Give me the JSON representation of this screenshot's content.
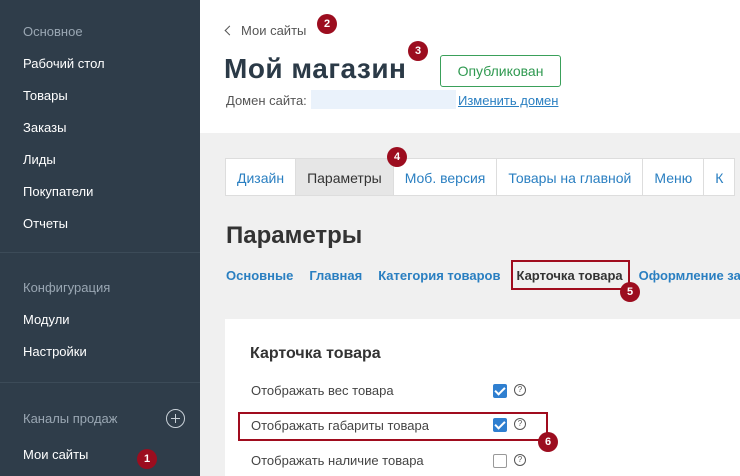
{
  "sidebar": {
    "section_main": "Основное",
    "items_main": [
      "Рабочий стол",
      "Товары",
      "Заказы",
      "Лиды",
      "Покупатели",
      "Отчеты"
    ],
    "section_config": "Конфигурация",
    "items_config": [
      "Модули",
      "Настройки"
    ],
    "section_channels": "Каналы продаж",
    "items_channels": [
      "Мои сайты"
    ]
  },
  "header": {
    "back_label": "Мои сайты",
    "site_title": "Мой магазин",
    "status_label": "Опубликован",
    "domain_label": "Домен сайта:",
    "domain_change_link": "Изменить домен"
  },
  "tabs": [
    "Дизайн",
    "Параметры",
    "Моб. версия",
    "Товары на главной",
    "Меню",
    "К"
  ],
  "params": {
    "title": "Параметры",
    "subnav": [
      "Основные",
      "Главная",
      "Категория товаров",
      "Карточка товара",
      "Оформление за"
    ]
  },
  "card": {
    "title": "Карточка товара",
    "rows": [
      {
        "label": "Отображать вес товара",
        "checked": true
      },
      {
        "label": "Отображать габариты товара",
        "checked": true
      },
      {
        "label": "Отображать наличие товара",
        "checked": false
      }
    ],
    "help_glyph": "?"
  },
  "annotations": [
    "1",
    "2",
    "3",
    "4",
    "5",
    "6"
  ],
  "colors": {
    "sidebar_bg": "#2f3d4a",
    "accent_link": "#2a7fc1",
    "published_green": "#2f9950",
    "annotation_red": "#9c0d1f"
  }
}
